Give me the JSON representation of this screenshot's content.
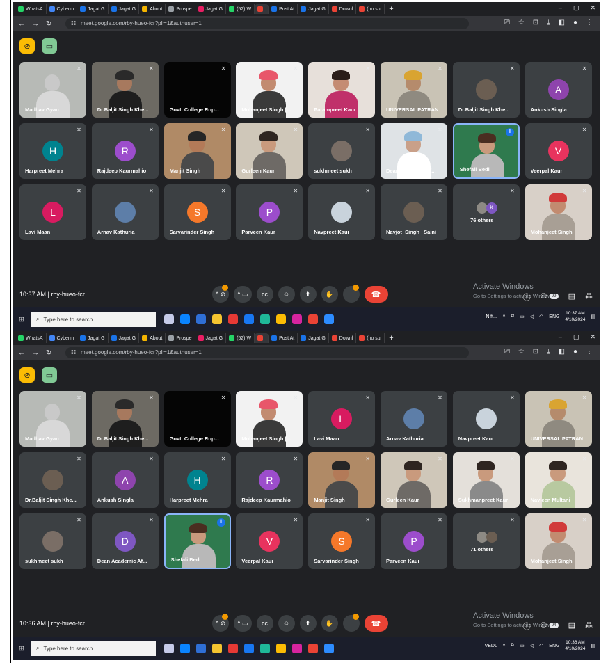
{
  "tabs": [
    {
      "label": "WhatsA",
      "color": "#25d366"
    },
    {
      "label": "Cyberm",
      "color": "#4285f4"
    },
    {
      "label": "Jagat G",
      "color": "#1a73e8"
    },
    {
      "label": "Jagat G",
      "color": "#1a73e8"
    },
    {
      "label": "About",
      "color": "#f4b400"
    },
    {
      "label": "Prospe",
      "color": "#9aa0a6"
    },
    {
      "label": "Jagat G",
      "color": "#e91e63"
    },
    {
      "label": "(52) W",
      "color": "#25d366"
    },
    {
      "label": "",
      "color": "#ea4335"
    },
    {
      "label": "Post At",
      "color": "#1a73e8"
    },
    {
      "label": "Jagat G",
      "color": "#1a73e8"
    },
    {
      "label": "Downl",
      "color": "#ea4335"
    },
    {
      "label": "(no sul",
      "color": "#ea4335"
    }
  ],
  "url": "meet.google.com/rby-hueo-fcr?pli=1&authuser=1",
  "screens": [
    {
      "time": "10:37 AM",
      "meeting_code": "rby-hueo-fcr",
      "activate_title": "Activate Windows",
      "activate_sub": "Go to Settings to activate Windows.",
      "people_badge": "99",
      "clock_time": "10:37 AM",
      "clock_date": "4/10/2024",
      "tray_app": "Nift...",
      "search_placeholder": "Type here to search",
      "lang": "ENG",
      "tiles": [
        {
          "name": "Madhav Gyan",
          "kind": "video",
          "bg": "#b7bab6",
          "skin": "#c9c9c9",
          "turban": "",
          "cloth": "#d8d8d8"
        },
        {
          "name": "Dr.Baljit Singh Khe...",
          "kind": "video",
          "bg": "#6d6a63",
          "skin": "#a7795e",
          "turban": "#2a2a2a",
          "cloth": "#1e1e1e"
        },
        {
          "name": "Govt. College Rop...",
          "kind": "video",
          "bg": "#050505",
          "skin": "",
          "turban": "",
          "cloth": ""
        },
        {
          "name": "Mohanjeet Singh [...",
          "kind": "video",
          "bg": "#f2f2f2",
          "skin": "#c28b70",
          "turban": "#e8566a",
          "cloth": "#3a3a3a"
        },
        {
          "name": "Parampreet Kaur",
          "kind": "video",
          "bg": "#e7e0da",
          "skin": "#c48c73",
          "turban": "#2a1d18",
          "cloth": "#c0306a"
        },
        {
          "name": "UNIVERSAL PATRAN",
          "kind": "video",
          "bg": "#c9c3b5",
          "skin": "#b58b6c",
          "turban": "#d9a431",
          "cloth": "#8f8a80"
        },
        {
          "name": "Dr.Baljit Singh Khe...",
          "kind": "avatar",
          "color": "#6b5e52",
          "letter": ""
        },
        {
          "name": "Ankush Singla",
          "kind": "avatar",
          "color": "#8e44ad",
          "letter": "A"
        },
        {
          "name": "Harpreet Mehra",
          "kind": "avatar",
          "color": "#00838f",
          "letter": "H"
        },
        {
          "name": "Rajdeep Kaurmahio",
          "kind": "avatar",
          "color": "#9c4dcc",
          "letter": "R"
        },
        {
          "name": "Manjit Singh",
          "kind": "video",
          "bg": "#b08a66",
          "skin": "#b37a58",
          "turban": "#262626",
          "cloth": "#4a4a4a"
        },
        {
          "name": "Gurleen Kaur",
          "kind": "video",
          "bg": "#cfc7b9",
          "skin": "#c99a7d",
          "turban": "#2e2520",
          "cloth": "#6e6a66"
        },
        {
          "name": "sukhmeet sukh",
          "kind": "avatar",
          "color": "#7a6e66",
          "letter": ""
        },
        {
          "name": "Dean Academic Af...",
          "kind": "video",
          "bg": "#dfe3e6",
          "skin": "#c9a089",
          "turban": "#8fb8d8",
          "cloth": "#ffffff"
        },
        {
          "name": "Shefali Bedi",
          "kind": "video",
          "bg": "#2f7a4e",
          "skin": "#c99a7d",
          "turban": "#4a2d20",
          "cloth": "#b8b8b8",
          "speaking": true
        },
        {
          "name": "Veerpal Kaur",
          "kind": "avatar",
          "color": "#e8335e",
          "letter": "V"
        },
        {
          "name": "Lavi Maan",
          "kind": "avatar",
          "color": "#d81b60",
          "letter": "L"
        },
        {
          "name": "Arnav Kathuria",
          "kind": "avatar",
          "color": "#5d7ea8",
          "letter": ""
        },
        {
          "name": "Sarvarinder Singh",
          "kind": "avatar",
          "color": "#f5782a",
          "letter": "S"
        },
        {
          "name": "Parveen Kaur",
          "kind": "avatar",
          "color": "#9c4dcc",
          "letter": "P"
        },
        {
          "name": "Navpreet Kaur",
          "kind": "avatar",
          "color": "#c9d3dc",
          "letter": ""
        },
        {
          "name": "Navjot_Singh _Saini",
          "kind": "avatar",
          "color": "#6b5e52",
          "letter": ""
        },
        {
          "name": "76 others",
          "kind": "others",
          "letter": "K",
          "color": "#7e57c2"
        },
        {
          "name": "Mohanjeet Singh",
          "kind": "video",
          "bg": "#d8d0c8",
          "skin": "#c28b70",
          "turban": "#d13a3a",
          "cloth": "#a89f95"
        }
      ]
    },
    {
      "time": "10:36 AM",
      "meeting_code": "rby-hueo-fcr",
      "activate_title": "Activate Windows",
      "activate_sub": "Go to Settings to activate Windows.",
      "people_badge": "94",
      "clock_time": "10:36 AM",
      "clock_date": "4/10/2024",
      "tray_app": "VEDL",
      "search_placeholder": "Type here to search",
      "lang": "ENG",
      "tiles": [
        {
          "name": "Madhav Gyan",
          "kind": "video",
          "bg": "#b7bab6",
          "skin": "#c9c9c9",
          "turban": "",
          "cloth": "#d8d8d8"
        },
        {
          "name": "Dr.Baljit Singh Khe...",
          "kind": "video",
          "bg": "#6d6a63",
          "skin": "#a7795e",
          "turban": "#2a2a2a",
          "cloth": "#1e1e1e"
        },
        {
          "name": "Govt. College Rop...",
          "kind": "video",
          "bg": "#050505",
          "skin": "",
          "turban": "",
          "cloth": ""
        },
        {
          "name": "Mohanjeet Singh [...",
          "kind": "video",
          "bg": "#f2f2f2",
          "skin": "#c28b70",
          "turban": "#e8566a",
          "cloth": "#3a3a3a"
        },
        {
          "name": "Lavi Maan",
          "kind": "avatar",
          "color": "#d81b60",
          "letter": "L"
        },
        {
          "name": "Arnav Kathuria",
          "kind": "avatar",
          "color": "#5d7ea8",
          "letter": ""
        },
        {
          "name": "Navpreet Kaur",
          "kind": "avatar",
          "color": "#c9d3dc",
          "letter": ""
        },
        {
          "name": "UNIVERSAL PATRAN",
          "kind": "video",
          "bg": "#c9c3b5",
          "skin": "#b58b6c",
          "turban": "#d9a431",
          "cloth": "#8f8a80"
        },
        {
          "name": "Dr.Baljit Singh Khe...",
          "kind": "avatar",
          "color": "#6b5e52",
          "letter": ""
        },
        {
          "name": "Ankush Singla",
          "kind": "avatar",
          "color": "#8e44ad",
          "letter": "A"
        },
        {
          "name": "Harpreet Mehra",
          "kind": "avatar",
          "color": "#00838f",
          "letter": "H"
        },
        {
          "name": "Rajdeep Kaurmahio",
          "kind": "avatar",
          "color": "#9c4dcc",
          "letter": "R"
        },
        {
          "name": "Manjit Singh",
          "kind": "video",
          "bg": "#b08a66",
          "skin": "#b37a58",
          "turban": "#262626",
          "cloth": "#4a4a4a"
        },
        {
          "name": "Gurleen Kaur",
          "kind": "video",
          "bg": "#cfc7b9",
          "skin": "#c99a7d",
          "turban": "#2e2520",
          "cloth": "#6e6a66"
        },
        {
          "name": "Sukhmanpreet Kaur",
          "kind": "video",
          "bg": "#e4e0da",
          "skin": "#c99a7d",
          "turban": "#2e2520",
          "cloth": "#8a8a8a"
        },
        {
          "name": "Navleen Multani",
          "kind": "video",
          "bg": "#e9e4dc",
          "skin": "#c99a7d",
          "turban": "#2e2520",
          "cloth": "#b8c9a0"
        },
        {
          "name": "sukhmeet sukh",
          "kind": "avatar",
          "color": "#7a6e66",
          "letter": ""
        },
        {
          "name": "Dean Academic Af...",
          "kind": "avatar",
          "color": "#7e57c2",
          "letter": "D"
        },
        {
          "name": "Shefali Bedi",
          "kind": "video",
          "bg": "#2f7a4e",
          "skin": "#c99a7d",
          "turban": "#4a2d20",
          "cloth": "#b8b8b8",
          "speaking": true
        },
        {
          "name": "Veerpal Kaur",
          "kind": "avatar",
          "color": "#e8335e",
          "letter": "V"
        },
        {
          "name": "Sarvarinder Singh",
          "kind": "avatar",
          "color": "#f5782a",
          "letter": "S"
        },
        {
          "name": "Parveen Kaur",
          "kind": "avatar",
          "color": "#9c4dcc",
          "letter": "P"
        },
        {
          "name": "71 others",
          "kind": "others",
          "letter": "",
          "color": "#6b5e52"
        },
        {
          "name": "Mohanjeet Singh",
          "kind": "video",
          "bg": "#d8d0c8",
          "skin": "#c28b70",
          "turban": "#d13a3a",
          "cloth": "#a89f95"
        }
      ]
    }
  ]
}
